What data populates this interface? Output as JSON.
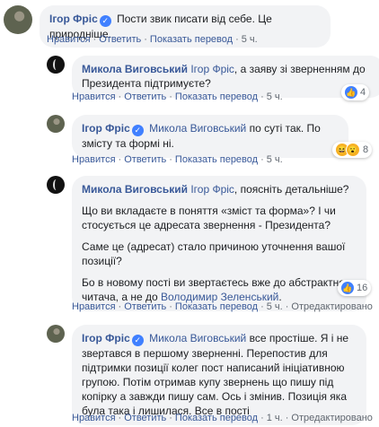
{
  "c1": {
    "author": "Ігор Фріс",
    "text": "Пости звик писати від себе. Це природніше.",
    "like": "Нравится",
    "reply": "Ответить",
    "translate": "Показать перевод",
    "time": "5 ч."
  },
  "c2": {
    "author": "Микола Виговський",
    "mention": "Ігор Фріс",
    "text": ", а заяву зі зверненням до Президента підтримуєте?",
    "like": "Нравится",
    "reply": "Ответить",
    "translate": "Показать перевод",
    "time": "5 ч.",
    "reactions": "4"
  },
  "c3": {
    "author": "Ігор Фріс",
    "mention": "Микола Виговський",
    "text": " по суті так. По змісту та формі ні.",
    "like": "Нравится",
    "reply": "Ответить",
    "translate": "Показать перевод",
    "time": "5 ч.",
    "reactions": "8"
  },
  "c4": {
    "author": "Микола Виговський",
    "mention": "Ігор Фріс",
    "line1": ", поясніть детальніше?",
    "p2": "Що ви вкладаєте в поняття «зміст та форма»? І чи стосується це адресата звернення - Президента?",
    "p3": "Саме це (адресат) стало причиною уточнення вашої позиції?",
    "p4": "Бо в новому пості ви звертаєтесь вже до абстрактного читача, а не до ",
    "p4_mention": "Володимир Зеленський",
    "p4_end": ".",
    "like": "Нравится",
    "reply": "Ответить",
    "translate": "Показать перевод",
    "time": "5 ч.",
    "edited": "Отредактировано",
    "reactions": "16"
  },
  "c5": {
    "author": "Ігор Фріс",
    "mention": "Микола Виговський",
    "text": " все простіше. Я і не звертався в першому зверненні. Перепостив для підтримки позиції колег пост написаний ініціативною групою. Потім отримав купу звернень що пишу під копірку а завжди пишу сам. Ось і змінив. Позиція яка була така і лишилася. Все в пості",
    "like": "Нравится",
    "reply": "Ответить",
    "translate": "Показать перевод",
    "time": "1 ч.",
    "edited": "Отредактировано"
  }
}
